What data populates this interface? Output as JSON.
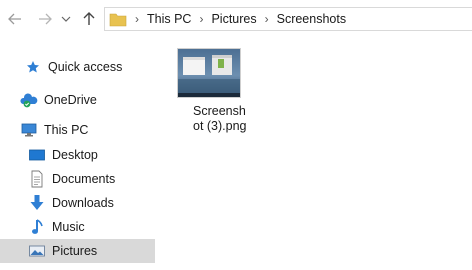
{
  "navigation": {
    "back_icon": "arrow-left-icon",
    "forward_icon": "arrow-right-icon",
    "recent_icon": "chevron-down-icon",
    "up_icon": "arrow-up-icon"
  },
  "address_bar": {
    "breadcrumbs": [
      {
        "label": "This PC"
      },
      {
        "label": "Pictures"
      },
      {
        "label": "Screenshots"
      }
    ]
  },
  "sidebar": {
    "items": [
      {
        "label": "Quick access",
        "icon": "star-icon"
      },
      {
        "label": "OneDrive",
        "icon": "cloud-icon"
      },
      {
        "label": "This PC",
        "icon": "computer-icon"
      },
      {
        "label": "Desktop",
        "icon": "desktop-icon"
      },
      {
        "label": "Documents",
        "icon": "documents-icon"
      },
      {
        "label": "Downloads",
        "icon": "download-icon"
      },
      {
        "label": "Music",
        "icon": "music-icon"
      },
      {
        "label": "Pictures",
        "icon": "pictures-icon",
        "selected": true
      }
    ]
  },
  "files": [
    {
      "name": "Screenshot (3).png",
      "icon": "image-thumbnail"
    }
  ],
  "colors": {
    "accent": "#0078d7",
    "folder": "#e8c250",
    "selected_bg": "#d9d9d9"
  }
}
